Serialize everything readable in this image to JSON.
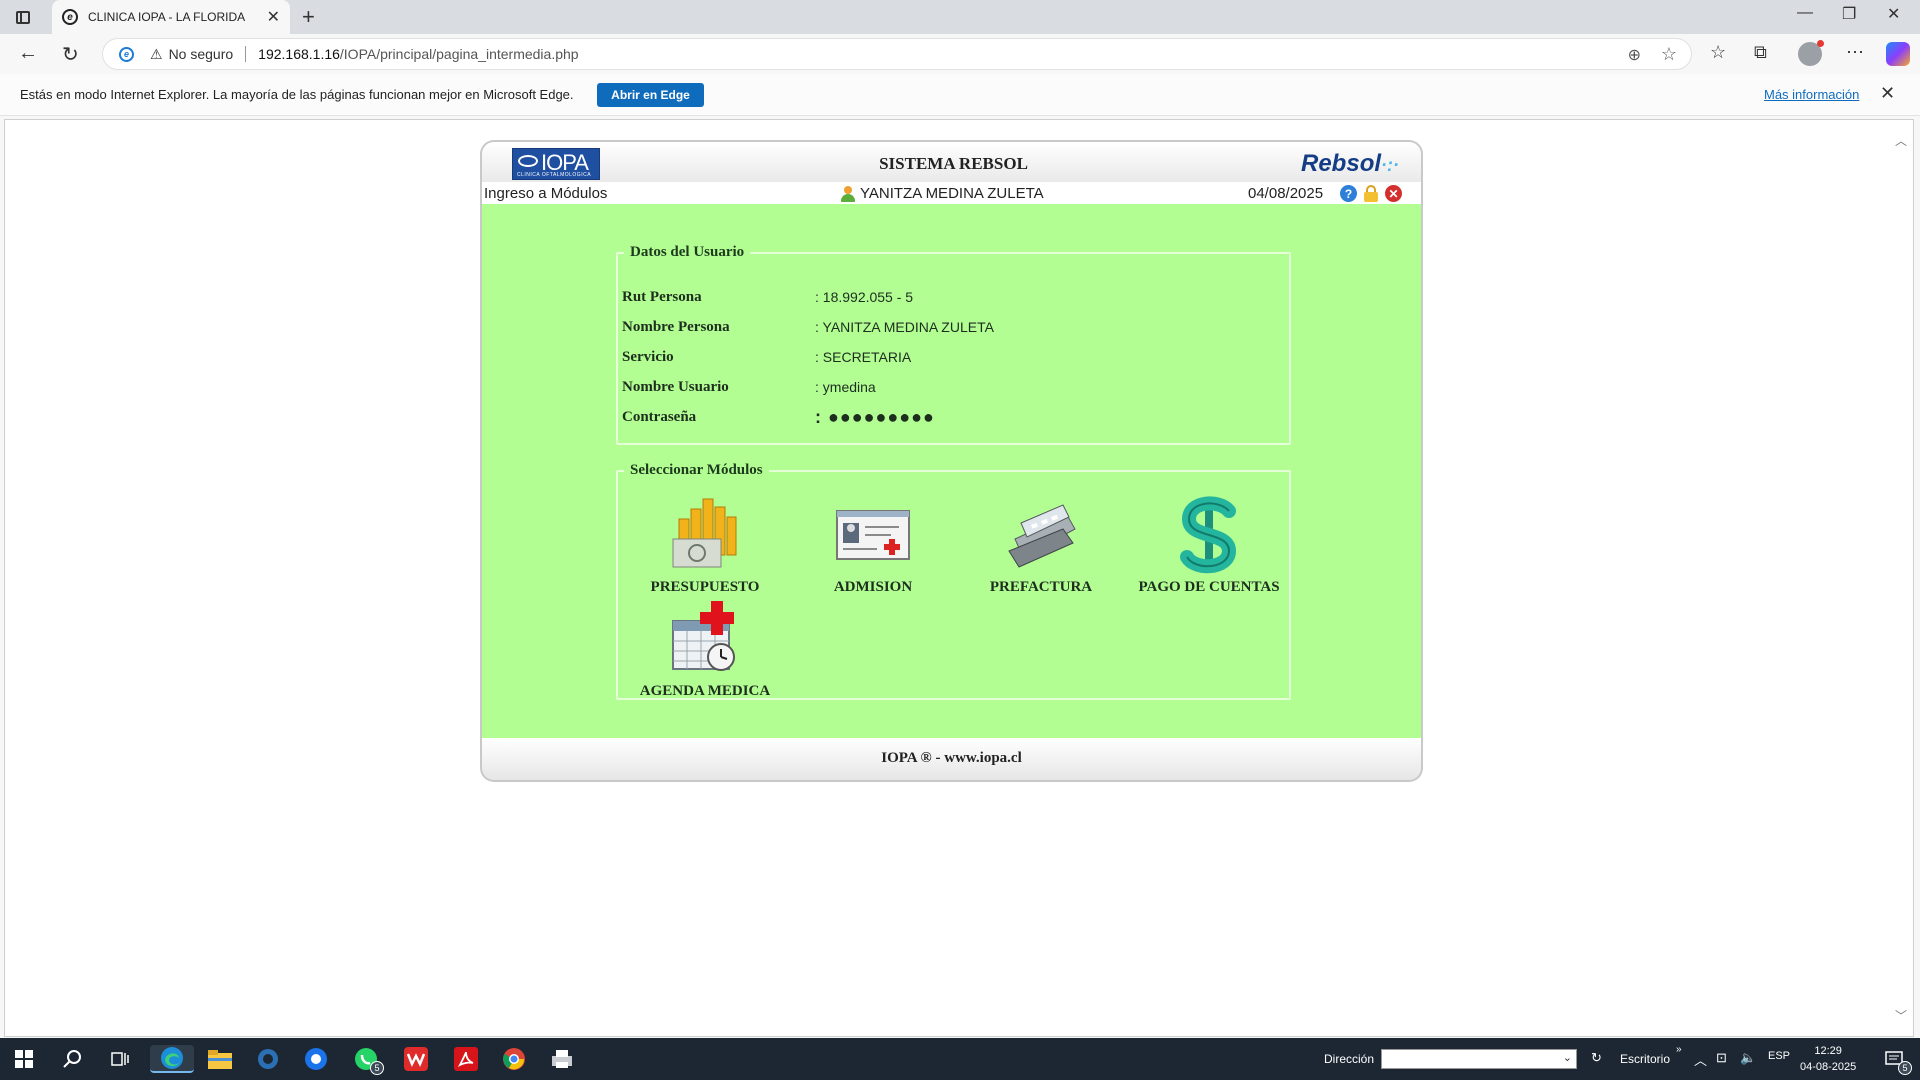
{
  "browser": {
    "tab_title": "CLINICA IOPA - LA FLORIDA",
    "security_label": "No seguro",
    "url_host": "192.168.1.16",
    "url_path": "/IOPA/principal/pagina_intermedia.php",
    "infobar_message": "Estás en modo Internet Explorer. La mayoría de las páginas funcionan mejor en Microsoft Edge.",
    "open_in_edge_label": "Abrir en Edge",
    "more_info_label": "Más información"
  },
  "app": {
    "logo_text": "IOPA",
    "logo_subtext": "CLINICA OFTALMOLOGICA",
    "title": "SISTEMA REBSOL",
    "brand": "Rebsol",
    "breadcrumb": "Ingreso a Módulos",
    "current_user": "YANITZA MEDINA ZULETA",
    "date": "04/08/2025",
    "footer": "IOPA ®  - www.iopa.cl",
    "colors": {
      "body_bg": "#b2fe93",
      "help": "#2d7fd8",
      "close": "#d32f2f"
    }
  },
  "user_data": {
    "legend": "Datos del Usuario",
    "rows": [
      {
        "label": "Rut Persona",
        "value": ": 18.992.055 - 5"
      },
      {
        "label": "Nombre Persona",
        "value": ": YANITZA MEDINA ZULETA"
      },
      {
        "label": "Servicio",
        "value": ": SECRETARIA"
      },
      {
        "label": "Nombre Usuario",
        "value": ": ymedina"
      },
      {
        "label": "Contraseña",
        "value": ": ●●●●●●●●●"
      }
    ]
  },
  "modules": {
    "legend": "Seleccionar Módulos",
    "items": [
      {
        "label": "PRESUPUESTO",
        "icon": "coins-money-icon"
      },
      {
        "label": "ADMISION",
        "icon": "id-card-icon"
      },
      {
        "label": "PREFACTURA",
        "icon": "cash-register-icon"
      },
      {
        "label": "PAGO DE CUENTAS",
        "icon": "dollar-sign-icon"
      },
      {
        "label": "AGENDA MEDICA",
        "icon": "medical-calendar-icon"
      }
    ]
  },
  "taskbar": {
    "address_label": "Dirección",
    "desktop_label": "Escritorio",
    "language": "ESP",
    "time": "12:29",
    "date": "04-08-2025",
    "whatsapp_badge": "5",
    "notifications_badge": "5"
  }
}
